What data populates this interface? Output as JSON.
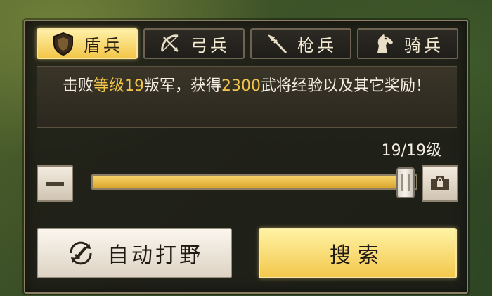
{
  "tabs": [
    {
      "label": "盾兵",
      "icon": "shield-icon",
      "active": true
    },
    {
      "label": "弓兵",
      "icon": "bow-icon",
      "active": false
    },
    {
      "label": "枪兵",
      "icon": "spear-icon",
      "active": false
    },
    {
      "label": "骑兵",
      "icon": "horse-icon",
      "active": false
    }
  ],
  "description": {
    "part1": "击败",
    "highlight1": "等级19",
    "part2": "叛军，获得",
    "highlight2": "2300",
    "part3": "武将经验以及其它奖励！"
  },
  "level": {
    "text": "19/19级",
    "current": 19,
    "max": 19
  },
  "slider": {
    "fill_fraction": 0.95
  },
  "buttons": {
    "auto_label": "自动打野",
    "search_label": "搜索"
  },
  "colors": {
    "accent_gold": "#f2c54a",
    "panel_bg": "#1c1a16",
    "text_light": "#f4efe2"
  }
}
